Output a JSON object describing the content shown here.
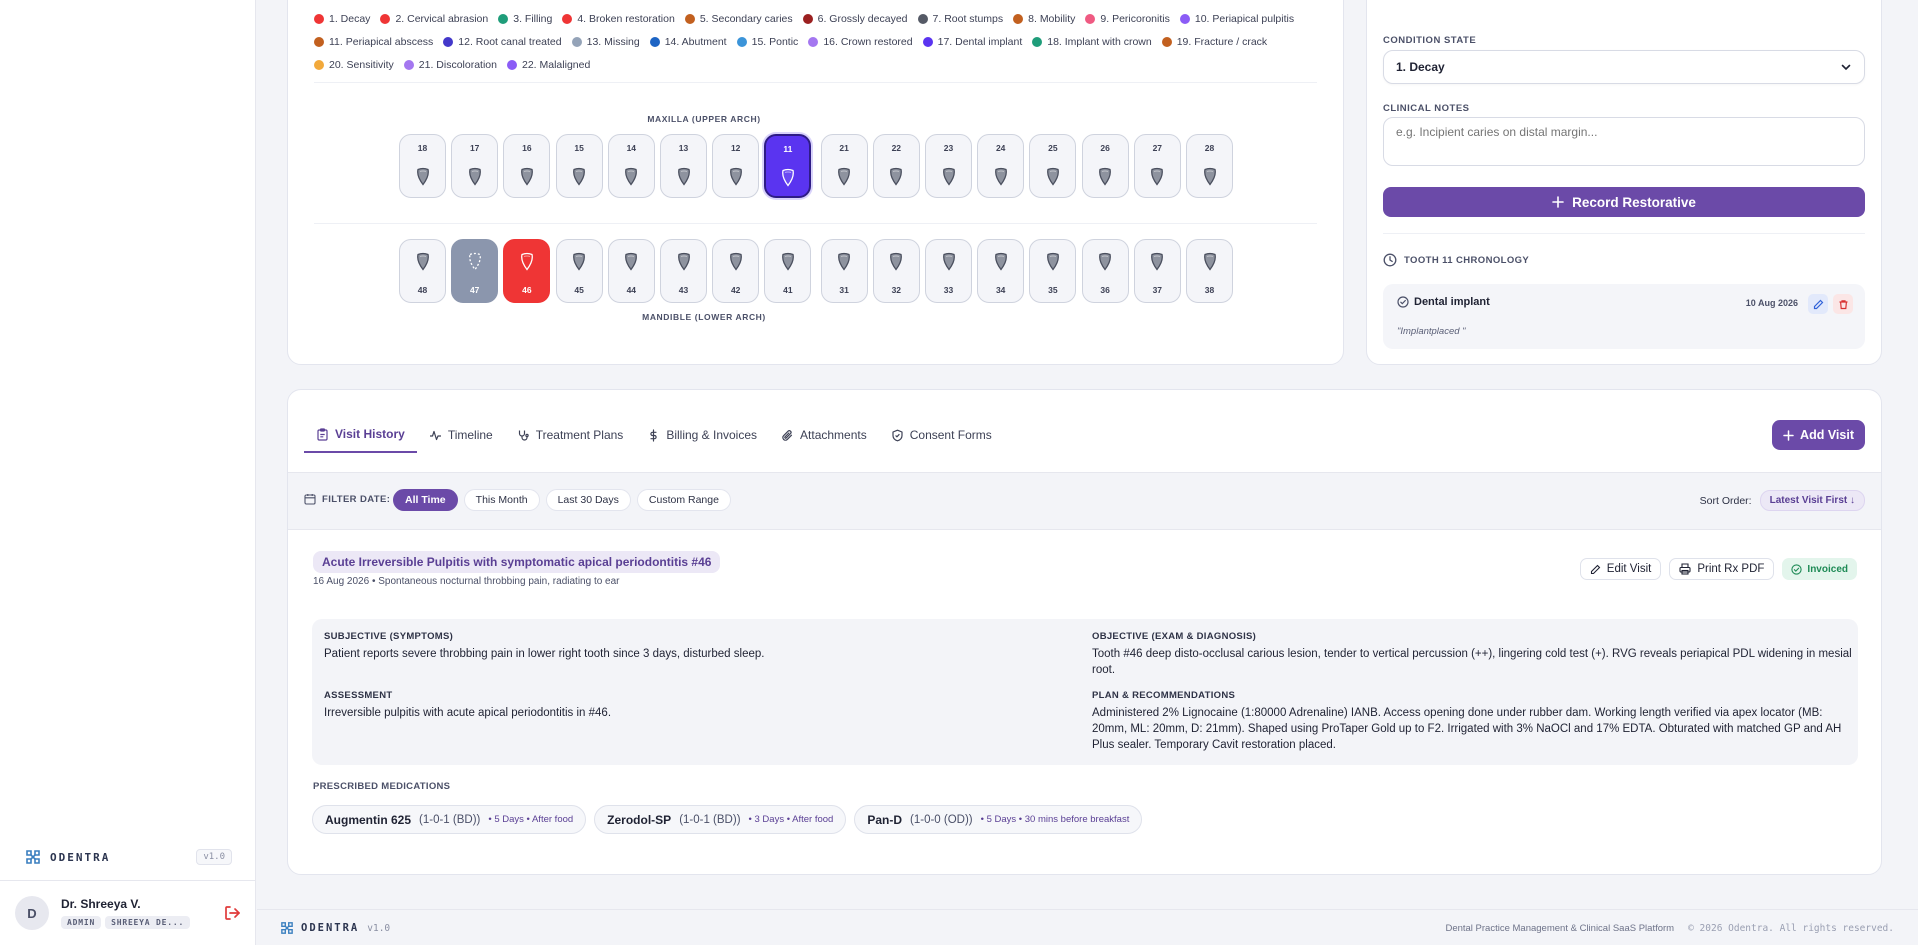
{
  "sidebar": {
    "brand": "ODENTRA",
    "version": "v1.0",
    "user": {
      "initial": "D",
      "name": "Dr. Shreeya V.",
      "role": "ADMIN",
      "clinic": "SHREEYA DE..."
    }
  },
  "legend": [
    {
      "label": "1. Decay",
      "color": "#ef3535"
    },
    {
      "label": "2. Cervical abrasion",
      "color": "#ef3535"
    },
    {
      "label": "3. Filling",
      "color": "#1f9d7a"
    },
    {
      "label": "4. Broken restoration",
      "color": "#ef3535"
    },
    {
      "label": "5. Secondary caries",
      "color": "#c2601f"
    },
    {
      "label": "6. Grossly decayed",
      "color": "#9b2020"
    },
    {
      "label": "7. Root stumps",
      "color": "#555a66"
    },
    {
      "label": "8. Mobility",
      "color": "#c2601f"
    },
    {
      "label": "9. Pericoronitis",
      "color": "#ef5a82"
    },
    {
      "label": "10. Periapical pulpitis",
      "color": "#8b5cf6"
    },
    {
      "label": "11. Periapical abscess",
      "color": "#c2601f"
    },
    {
      "label": "12. Root canal treated",
      "color": "#4338ca"
    },
    {
      "label": "13. Missing",
      "color": "#94a3b8"
    },
    {
      "label": "14. Abutment",
      "color": "#1d64c4"
    },
    {
      "label": "15. Pontic",
      "color": "#3b94d9"
    },
    {
      "label": "16. Crown restored",
      "color": "#a477f0"
    },
    {
      "label": "17. Dental implant",
      "color": "#5a34f0"
    },
    {
      "label": "18. Implant with crown",
      "color": "#1f9d7a"
    },
    {
      "label": "19. Fracture / crack",
      "color": "#c2601f"
    },
    {
      "label": "20. Sensitivity",
      "color": "#f2a93b"
    },
    {
      "label": "21. Discoloration",
      "color": "#a477f0"
    },
    {
      "label": "22. Malaligned",
      "color": "#8b5cf6"
    }
  ],
  "chart": {
    "upper_label": "MAXILLA (UPPER ARCH)",
    "lower_label": "MANDIBLE (LOWER ARCH)",
    "upper": [
      {
        "n": "18",
        "s": ""
      },
      {
        "n": "17",
        "s": ""
      },
      {
        "n": "16",
        "s": ""
      },
      {
        "n": "15",
        "s": ""
      },
      {
        "n": "14",
        "s": ""
      },
      {
        "n": "13",
        "s": ""
      },
      {
        "n": "12",
        "s": ""
      },
      {
        "n": "11",
        "s": "selected"
      },
      {
        "n": "21",
        "s": ""
      },
      {
        "n": "22",
        "s": ""
      },
      {
        "n": "23",
        "s": ""
      },
      {
        "n": "24",
        "s": ""
      },
      {
        "n": "25",
        "s": ""
      },
      {
        "n": "26",
        "s": ""
      },
      {
        "n": "27",
        "s": ""
      },
      {
        "n": "28",
        "s": ""
      }
    ],
    "lower": [
      {
        "n": "48",
        "s": ""
      },
      {
        "n": "47",
        "s": "missing"
      },
      {
        "n": "46",
        "s": "decay"
      },
      {
        "n": "45",
        "s": ""
      },
      {
        "n": "44",
        "s": ""
      },
      {
        "n": "43",
        "s": ""
      },
      {
        "n": "42",
        "s": ""
      },
      {
        "n": "41",
        "s": ""
      },
      {
        "n": "31",
        "s": ""
      },
      {
        "n": "32",
        "s": ""
      },
      {
        "n": "33",
        "s": ""
      },
      {
        "n": "34",
        "s": ""
      },
      {
        "n": "35",
        "s": ""
      },
      {
        "n": "36",
        "s": ""
      },
      {
        "n": "37",
        "s": ""
      },
      {
        "n": "38",
        "s": ""
      }
    ]
  },
  "side": {
    "condition_label": "CONDITION STATE",
    "condition_value": "1. Decay",
    "notes_label": "CLINICAL NOTES",
    "notes_placeholder": "e.g. Incipient caries on distal margin...",
    "record_label": "Record Restorative",
    "chrono_title": "TOOTH 11 CHRONOLOGY",
    "chrono_item": {
      "title": "Dental implant",
      "date": "10 Aug 2026",
      "note": "\"Implantplaced \""
    }
  },
  "visit": {
    "tabs": [
      "Visit History",
      "Timeline",
      "Treatment Plans",
      "Billing & Invoices",
      "Attachments",
      "Consent Forms"
    ],
    "add_label": "Add Visit",
    "filter_label": "FILTER DATE:",
    "filters": [
      "All Time",
      "This Month",
      "Last 30 Days",
      "Custom Range"
    ],
    "sort_label": "Sort Order:",
    "sort_value": "Latest Visit First ↓",
    "diagnosis": "Acute Irreversible Pulpitis with symptomatic apical periodontitis #46",
    "meta": "16 Aug 2026 • Spontaneous nocturnal throbbing pain, radiating to ear",
    "edit_label": "Edit Visit",
    "print_label": "Print Rx PDF",
    "status": "Invoiced",
    "subjective_h": "SUBJECTIVE (SYMPTOMS)",
    "subjective": "Patient reports severe throbbing pain in lower right tooth since 3 days, disturbed sleep.",
    "objective_h": "OBJECTIVE (EXAM & DIAGNOSIS)",
    "objective": "Tooth #46 deep disto-occlusal carious lesion, tender to vertical percussion (++), lingering cold test (+). RVG reveals periapical PDL widening in mesial root.",
    "assessment_h": "ASSESSMENT",
    "assessment": "Irreversible pulpitis with acute apical periodontitis in #46.",
    "plan_h": "PLAN & RECOMMENDATIONS",
    "plan": "Administered 2% Lignocaine (1:80000 Adrenaline) IANB. Access opening done under rubber dam. Working length verified via apex locator (MB: 20mm, ML: 20mm, D: 21mm). Shaped using ProTaper Gold up to F2. Irrigated with 3% NaOCl and 17% EDTA. Obturated with matched GP and AH Plus sealer. Temporary Cavit restoration placed.",
    "rx_label": "PRESCRIBED MEDICATIONS",
    "meds": [
      {
        "name": "Augmentin 625",
        "dose": "(1-0-1 (BD))",
        "info": "• 5 Days • After food"
      },
      {
        "name": "Zerodol-SP",
        "dose": "(1-0-1 (BD))",
        "info": "• 3 Days • After food"
      },
      {
        "name": "Pan-D",
        "dose": "(1-0-0 (OD))",
        "info": "• 5 Days • 30 mins before breakfast"
      }
    ]
  },
  "footer": {
    "brand": "ODENTRA",
    "version": "v1.0",
    "tagline": "Dental Practice Management & Clinical SaaS Platform",
    "copyright": "© 2026 Odentra. All rights reserved."
  }
}
